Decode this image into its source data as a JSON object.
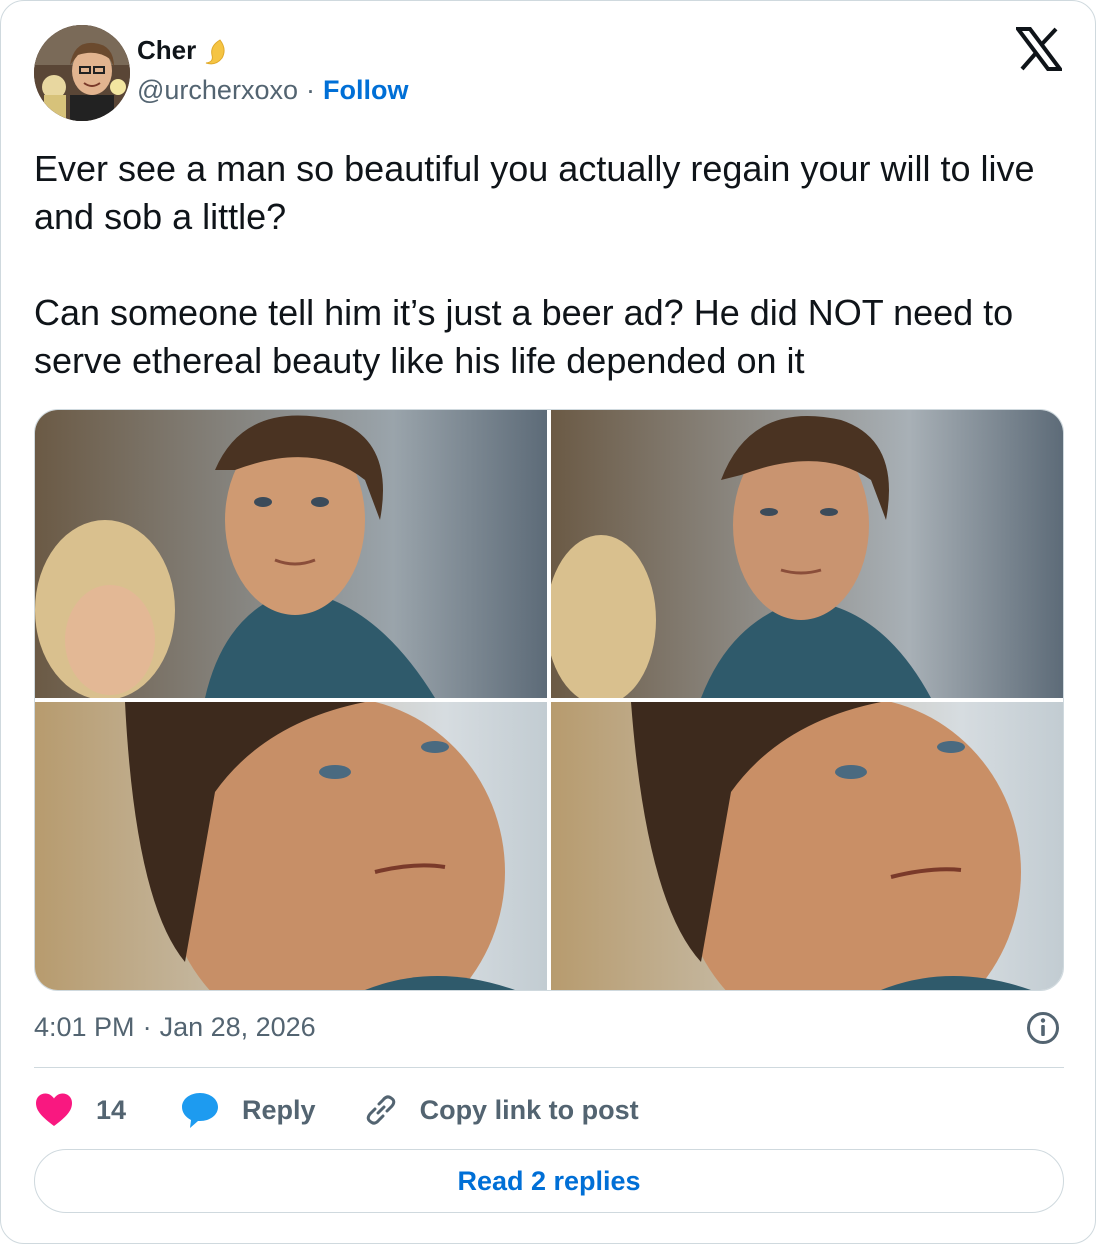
{
  "author": {
    "display_name": "Cher",
    "emoji_icon": "crescent-moon-icon",
    "handle": "@urcherxoxo",
    "separator": "·",
    "follow_label": "Follow"
  },
  "tweet": {
    "text": "Ever see a man so beautiful you actually regain your will to live and sob a little?\n\nCan someone tell him it’s just a beer ad? He did NOT need to serve ethereal beauty like his life depended on it",
    "media_count": 4,
    "time": "4:01 PM",
    "separator": "·",
    "date": "Jan 28, 2026"
  },
  "actions": {
    "like_count": "14",
    "reply_label": "Reply",
    "copy_link_label": "Copy link to post"
  },
  "footer": {
    "read_replies_label": "Read 2 replies"
  },
  "colors": {
    "link_blue": "#006fd6",
    "heart_pink": "#f91880",
    "reply_blue": "#1d9bf0",
    "secondary_text": "#536471",
    "border": "#cfd9de"
  }
}
